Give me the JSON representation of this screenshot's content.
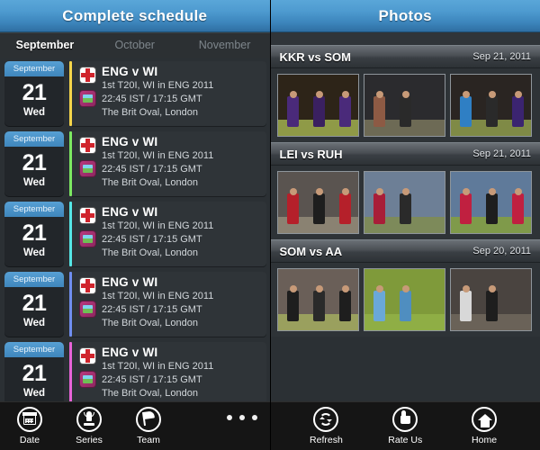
{
  "left_panel": {
    "title": "Complete schedule",
    "month_tabs": [
      {
        "label": "September",
        "active": true
      },
      {
        "label": "October",
        "active": false
      },
      {
        "label": "November",
        "active": false
      }
    ],
    "matches": [
      {
        "month": "September",
        "day": "21",
        "weekday": "Wed",
        "accent": "#f5d54a",
        "teams": "ENG v WI",
        "series": "1st T20I, WI in ENG 2011",
        "time": "22:45 IST / 17:15 GMT",
        "venue": "The Brit Oval, London"
      },
      {
        "month": "September",
        "day": "21",
        "weekday": "Wed",
        "accent": "#7ce861",
        "teams": "ENG v WI",
        "series": "1st T20I, WI in ENG 2011",
        "time": "22:45 IST / 17:15 GMT",
        "venue": "The Brit Oval, London"
      },
      {
        "month": "September",
        "day": "21",
        "weekday": "Wed",
        "accent": "#55e6e6",
        "teams": "ENG v WI",
        "series": "1st T20I, WI in ENG 2011",
        "time": "22:45 IST / 17:15 GMT",
        "venue": "The Brit Oval, London"
      },
      {
        "month": "September",
        "day": "21",
        "weekday": "Wed",
        "accent": "#6f8ef0",
        "teams": "ENG v WI",
        "series": "1st T20I, WI in ENG 2011",
        "time": "22:45 IST / 17:15 GMT",
        "venue": "The Brit Oval, London"
      },
      {
        "month": "September",
        "day": "21",
        "weekday": "Wed",
        "accent": "#e863d8",
        "teams": "ENG v WI",
        "series": "1st T20I, WI in ENG 2011",
        "time": "22:45 IST / 17:15 GMT",
        "venue": "The Brit Oval, London"
      }
    ],
    "toolbar": [
      {
        "label": "Date",
        "icon": "calendar-icon"
      },
      {
        "label": "Series",
        "icon": "trophy-icon"
      },
      {
        "label": "Team",
        "icon": "flag-icon"
      }
    ],
    "overflow_icon": "ellipsis-icon"
  },
  "right_panel": {
    "title": "Photos",
    "sections": [
      {
        "name": "KKR vs SOM",
        "date": "Sep 21,  2011",
        "photos": [
          {
            "sky": "#2d2418",
            "ground": "#8f9a47",
            "kits": [
              "#4a2a7a",
              "#3a2060",
              "#4a2a7a"
            ]
          },
          {
            "sky": "#2b2b2e",
            "ground": "#6d6a55",
            "kits": [
              "#8d5a44",
              "#2a2a2a"
            ]
          },
          {
            "sky": "#2a2522",
            "ground": "#7f8a46",
            "kits": [
              "#2f7fc4",
              "#2a2a2a",
              "#3b2470"
            ]
          }
        ]
      },
      {
        "name": "LEI vs RUH",
        "date": "Sep 21,  2011",
        "photos": [
          {
            "sky": "#5a5450",
            "ground": "#8a8272",
            "kits": [
              "#b5202a",
              "#1e1e1e",
              "#b5202a"
            ]
          },
          {
            "sky": "#6d7f96",
            "ground": "#7d8a5a",
            "kits": [
              "#a81e38",
              "#2a2a2a"
            ]
          },
          {
            "sky": "#5f7a9a",
            "ground": "#7f9a4a",
            "kits": [
              "#c02040",
              "#1e1e1e",
              "#c02040"
            ]
          }
        ]
      },
      {
        "name": "SOM vs AA",
        "date": "Sep 20,  2011",
        "photos": [
          {
            "sky": "#6a5f58",
            "ground": "#9aa05e",
            "kits": [
              "#1e1e1e",
              "#2a2a2a",
              "#1e1e1e"
            ]
          },
          {
            "sky": "#7f9a3a",
            "ground": "#8fae45",
            "kits": [
              "#6aa8d8",
              "#4f8ec0"
            ]
          },
          {
            "sky": "#4a4440",
            "ground": "#6a6258",
            "kits": [
              "#d8d8d8",
              "#1e1e1e"
            ]
          }
        ]
      }
    ],
    "toolbar": [
      {
        "label": "Refresh",
        "icon": "refresh-icon"
      },
      {
        "label": "Rate Us",
        "icon": "thumbs-up-icon"
      },
      {
        "label": "Home",
        "icon": "home-icon"
      }
    ]
  }
}
